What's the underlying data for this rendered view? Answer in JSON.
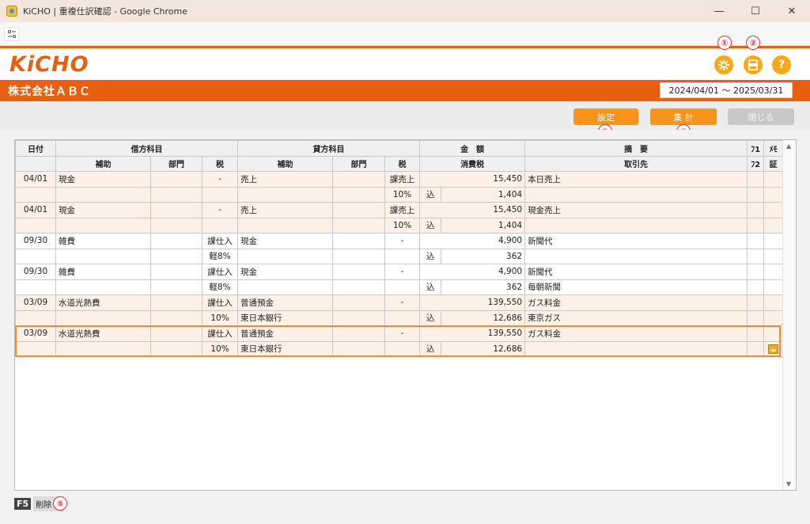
{
  "window": {
    "title": "KiCHO | 重複仕訳確認 - Google Chrome",
    "controls": {
      "minimize": "—",
      "maximize": "☐",
      "close": "✕"
    }
  },
  "header": {
    "logo": "KiCHO",
    "company": "株式会社ＡＢＣ",
    "period": "2024/04/01 ～ 2025/03/31"
  },
  "callouts": [
    "①",
    "②",
    "③",
    "④",
    "⑤"
  ],
  "icons": {
    "settings": "gear-icon",
    "pdf": "pdf-icon",
    "help": "help-icon",
    "help_glyph": "?"
  },
  "buttons": {
    "settings": "設定",
    "summary": "集 計",
    "close": "閉じる"
  },
  "table": {
    "header1": {
      "date": "日付",
      "debit": "借方科目",
      "credit": "貸方科目",
      "amount": "金　額",
      "summary": "摘　要",
      "fu1": "ﾌ1",
      "memo": "ﾒﾓ"
    },
    "header2": {
      "sub": "補助",
      "dept": "部門",
      "tax": "税",
      "sub2": "補助",
      "dept2": "部門",
      "tax2": "税",
      "ctax": "消費税",
      "client": "取引先",
      "fu2": "ﾌ2",
      "proof": "証"
    },
    "entries": [
      {
        "date": "04/01",
        "debit": "現金",
        "dtax": "-",
        "credit": "売上",
        "ctax": "課売上",
        "amount": "15,450",
        "summary": "本日売上",
        "debit_sub": "",
        "dtax2": "",
        "credit_sub": "",
        "ctax2": "10%",
        "incl": "込",
        "tax_amount": "1,404",
        "client": ""
      },
      {
        "date": "04/01",
        "debit": "現金",
        "dtax": "-",
        "credit": "売上",
        "ctax": "課売上",
        "amount": "15,450",
        "summary": "現金売上",
        "debit_sub": "",
        "dtax2": "",
        "credit_sub": "",
        "ctax2": "10%",
        "incl": "込",
        "tax_amount": "1,404",
        "client": ""
      },
      {
        "date": "09/30",
        "debit": "雑費",
        "dtax": "課仕入",
        "credit": "現金",
        "ctax": "-",
        "amount": "4,900",
        "summary": "新聞代",
        "debit_sub": "",
        "dtax2": "軽8%",
        "credit_sub": "",
        "ctax2": "",
        "incl": "込",
        "tax_amount": "362",
        "client": ""
      },
      {
        "date": "09/30",
        "debit": "雑費",
        "dtax": "課仕入",
        "credit": "現金",
        "ctax": "-",
        "amount": "4,900",
        "summary": "新聞代",
        "debit_sub": "",
        "dtax2": "軽8%",
        "credit_sub": "",
        "ctax2": "",
        "incl": "込",
        "tax_amount": "362",
        "client": "毎朝新聞"
      },
      {
        "date": "03/09",
        "debit": "水道光熱費",
        "dtax": "課仕入",
        "credit": "普通預金",
        "ctax": "-",
        "amount": "139,550",
        "summary": "ガス料金",
        "debit_sub": "",
        "dtax2": "10%",
        "credit_sub": "東日本銀行",
        "ctax2": "",
        "incl": "込",
        "tax_amount": "12,686",
        "client": "東京ガス"
      },
      {
        "date": "03/09",
        "debit": "水道光熱費",
        "dtax": "課仕入",
        "credit": "普通預金",
        "ctax": "-",
        "amount": "139,550",
        "summary": "ガス料金",
        "debit_sub": "",
        "dtax2": "10%",
        "credit_sub": "東日本銀行",
        "ctax2": "",
        "incl": "込",
        "tax_amount": "12,686",
        "client": ""
      }
    ]
  },
  "footer": {
    "key": "F5",
    "label": "削除"
  }
}
